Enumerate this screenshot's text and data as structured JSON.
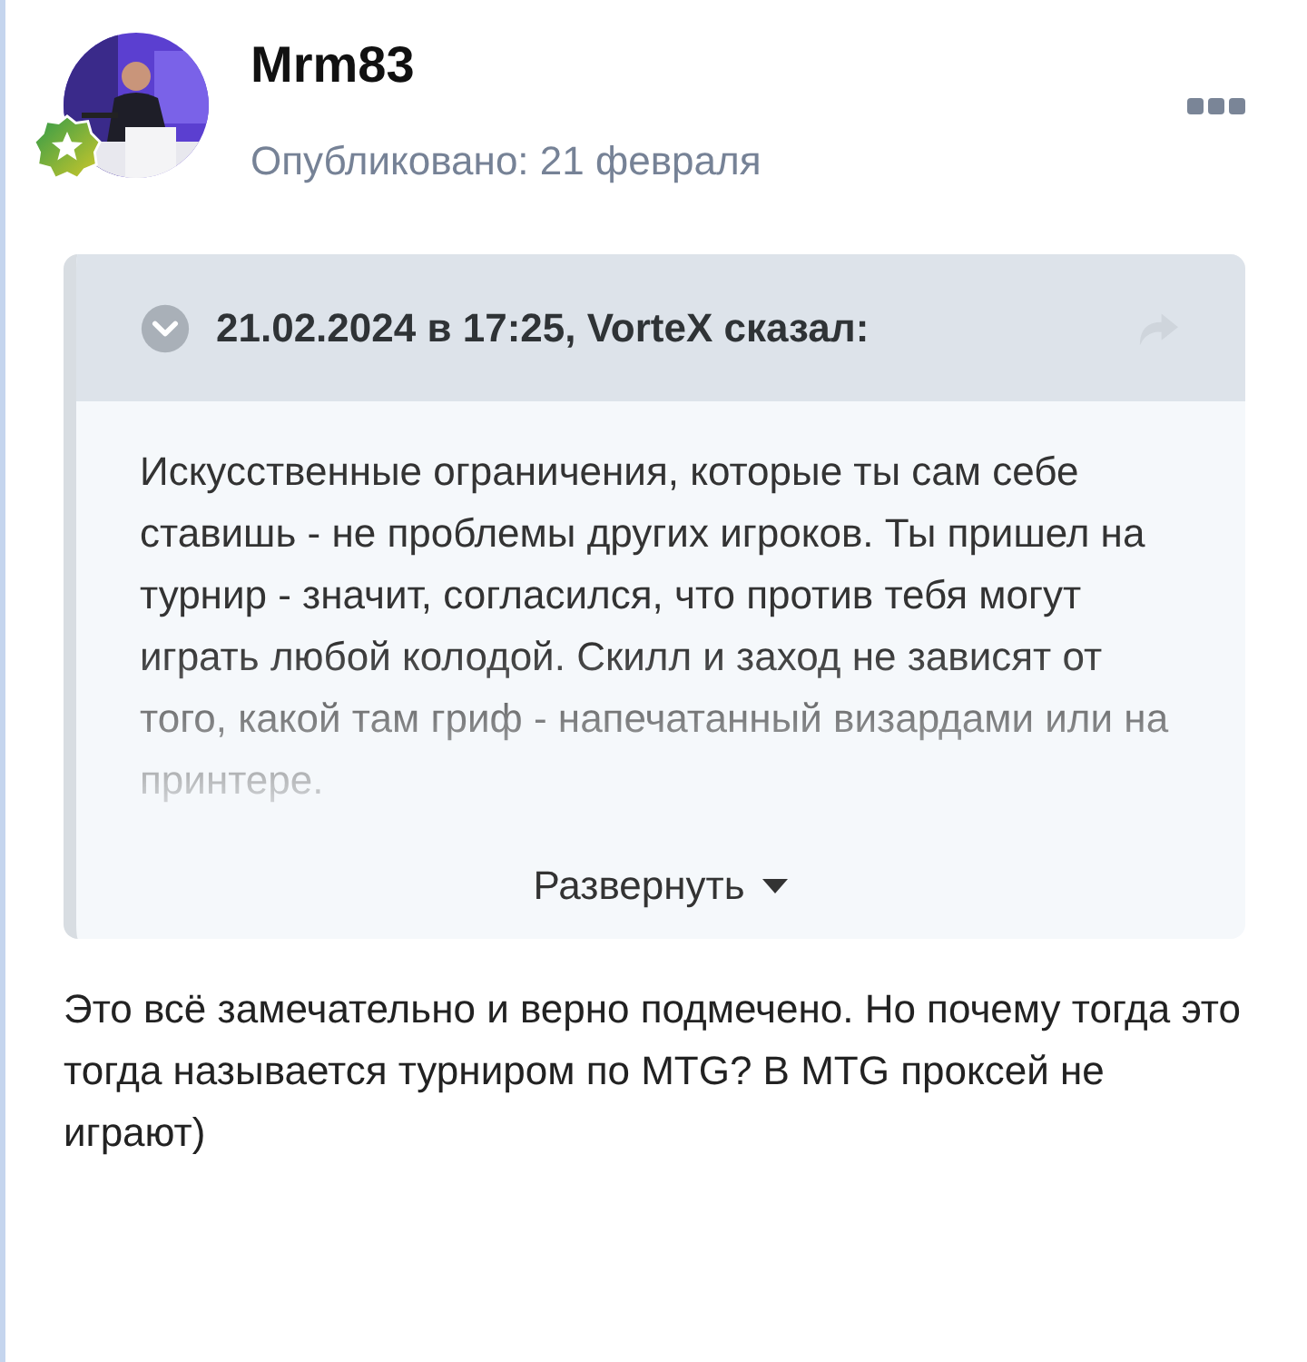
{
  "post": {
    "author": "Mrm83",
    "published": "Опубликовано: 21 февраля"
  },
  "quote": {
    "header": "21.02.2024 в 17:25, VorteX сказал:",
    "text": "Искусственные ограничения, которые ты сам себе ставишь - не проблемы других игроков. Ты пришел на турнир - значит, согласился, что против тебя могут играть любой колодой. Скилл и заход не зависят от того, какой там гриф - напечатанный визардами или на принтере.",
    "collapsed": true,
    "expand_label": "Развернуть"
  },
  "body": "Это всё замечательно и верно подмечено. Но почему тогда это тогда называется турниром по MTG? В MTG проксей не играют)"
}
